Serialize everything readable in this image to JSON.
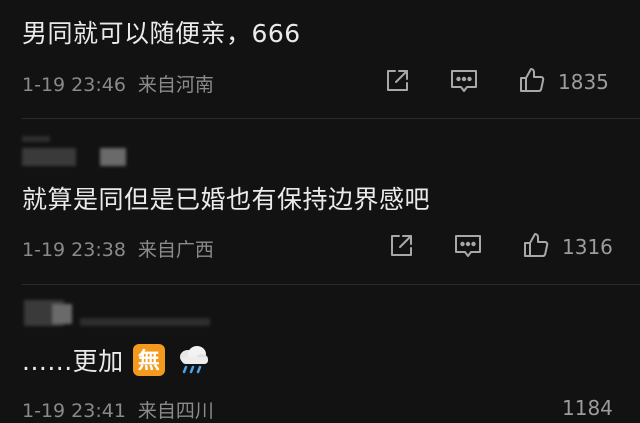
{
  "comments": [
    {
      "text": "男同就可以随便亲，666",
      "time": "1-19 23:46",
      "location": "来自河南",
      "likes": "1835"
    },
    {
      "text": "就算是同但是已婚也有保持边界感吧",
      "time": "1-19 23:38",
      "location": "来自广西",
      "likes": "1316"
    },
    {
      "text": "......更加",
      "emoji": [
        "no-symbol-emoji",
        "rain-cloud-emoji"
      ],
      "emoji_text": "無",
      "time": "1-19 23:41",
      "location": "来自四川",
      "likes": "1184"
    }
  ],
  "icons": [
    "share-icon",
    "comment-icon",
    "like-icon"
  ],
  "colors": {
    "background": "#121212",
    "text": "#eaeaea",
    "meta": "#8a8a8a",
    "emoji_orange": "#f39a1e"
  }
}
